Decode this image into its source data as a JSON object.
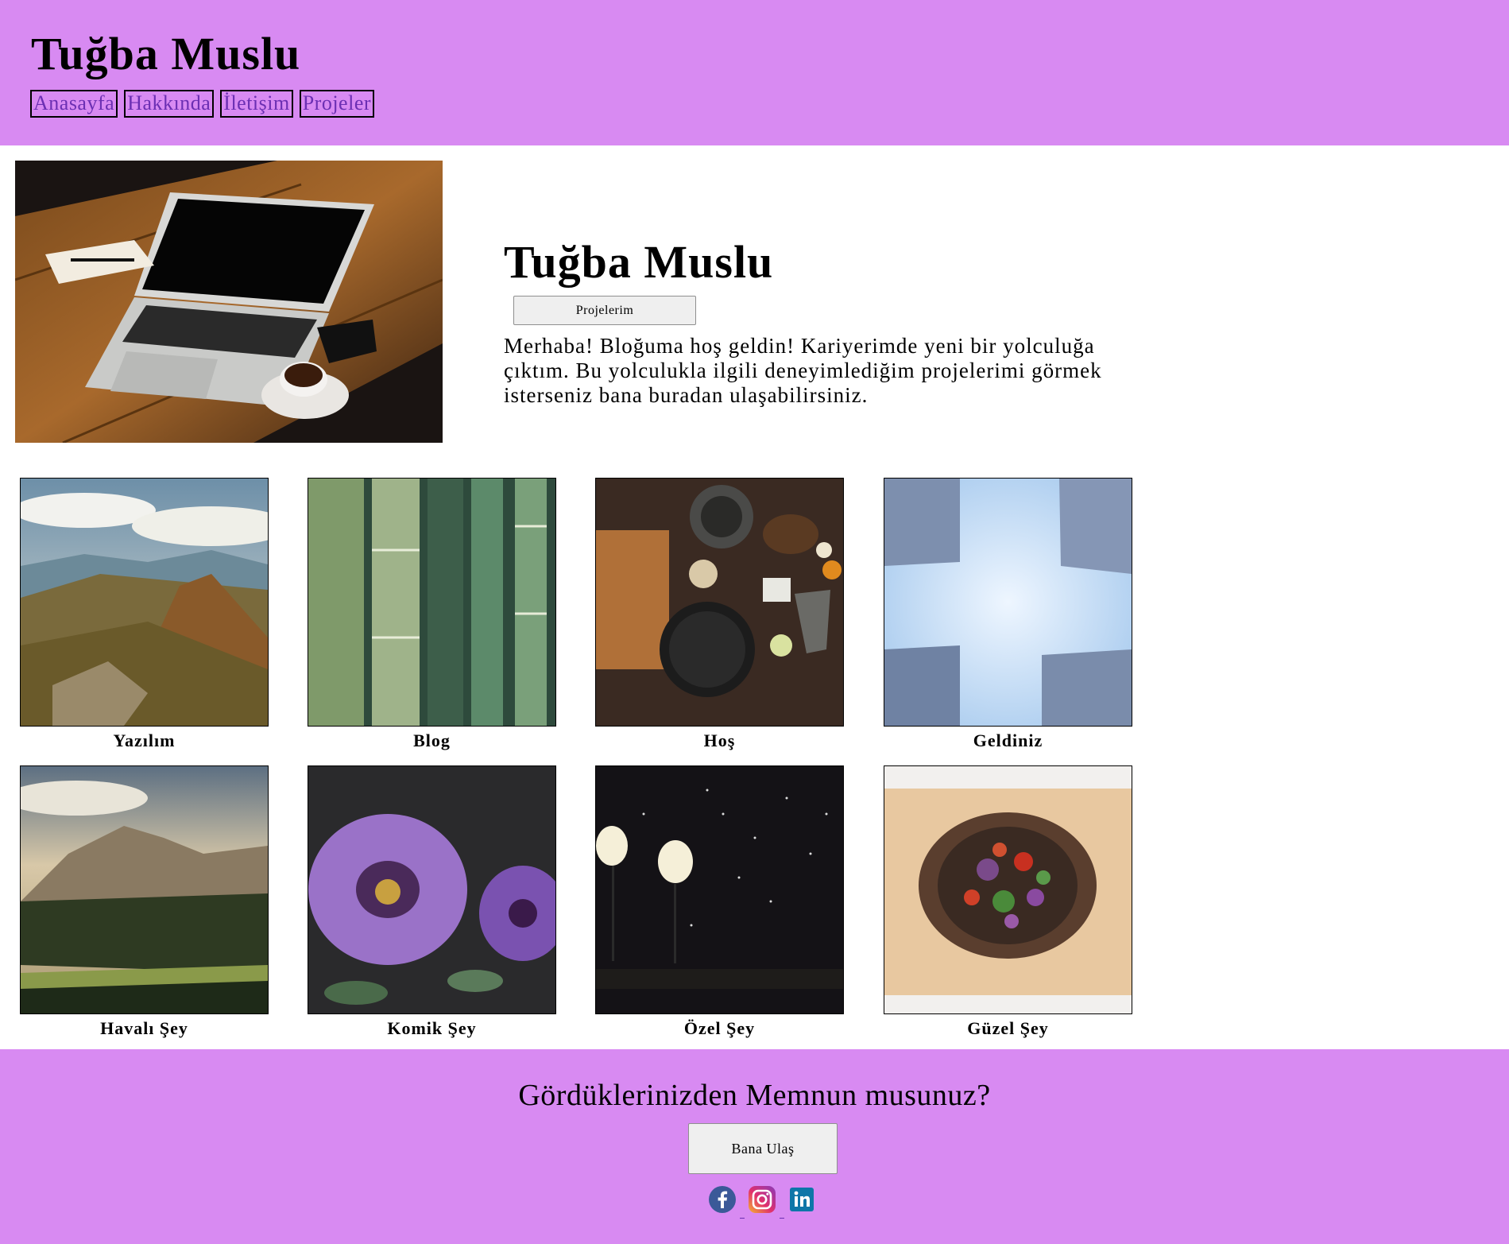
{
  "header": {
    "title": "Tuğba Muslu",
    "nav": [
      "Anasayfa",
      "Hakkında",
      "İletişim",
      "Projeler"
    ]
  },
  "hero": {
    "title": "Tuğba Muslu",
    "button": "Projelerim",
    "text": "Merhaba! Bloğuma hoş geldin! Kariyerimde yeni bir yolculuğa çıktım. Bu yolculukla ilgili deneyimlediğim projelerimi görmek isterseniz bana buradan ulaşabilirsiniz."
  },
  "gallery": [
    {
      "caption": "Yazılım"
    },
    {
      "caption": "Blog"
    },
    {
      "caption": "Hoş"
    },
    {
      "caption": "Geldiniz"
    },
    {
      "caption": "Havalı Şey"
    },
    {
      "caption": "Komik Şey"
    },
    {
      "caption": "Özel Şey"
    },
    {
      "caption": "Güzel Şey"
    }
  ],
  "footer": {
    "title": "Gördüklerinizden Memnun musunuz?",
    "button": "Bana Ulaş",
    "socials": [
      "facebook-icon",
      "instagram-icon",
      "linkedin-icon"
    ]
  },
  "colors": {
    "header_bg": "#d88af2",
    "footer_bg": "#d88af2",
    "nav_link": "#6b2fb3"
  }
}
